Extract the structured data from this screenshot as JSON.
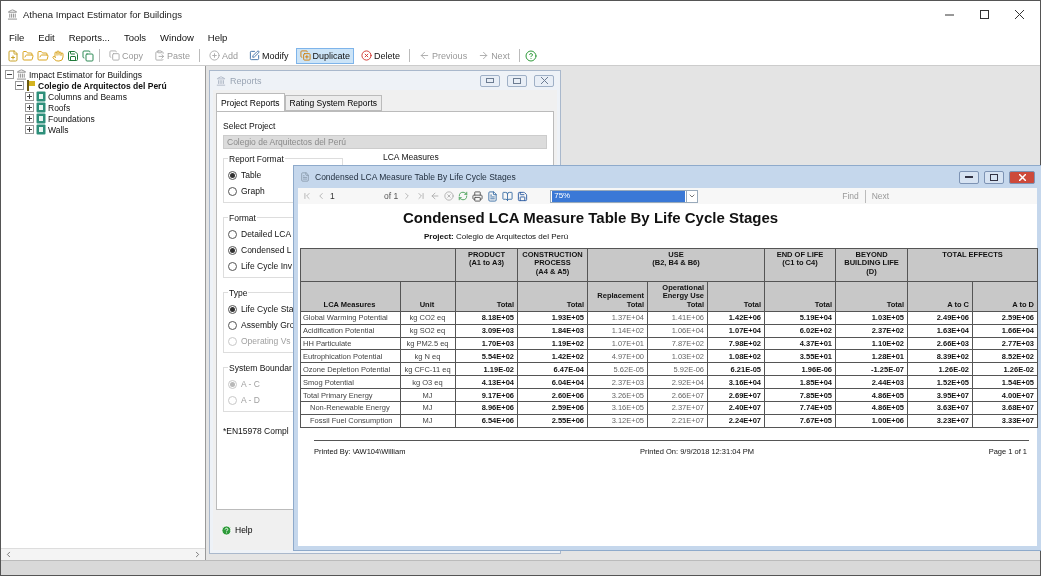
{
  "window": {
    "title": "Athena Impact Estimator for Buildings"
  },
  "menu": [
    "File",
    "Edit",
    "Reports...",
    "Tools",
    "Window",
    "Help"
  ],
  "toolbar": {
    "edit": [
      {
        "label": "Copy",
        "disabled": true,
        "highlighted": false
      },
      {
        "label": "Paste",
        "disabled": true,
        "highlighted": false
      }
    ],
    "actions": [
      {
        "label": "Add",
        "disabled": true,
        "highlighted": false
      },
      {
        "label": "Modify",
        "disabled": false,
        "highlighted": false
      },
      {
        "label": "Duplicate",
        "disabled": false,
        "highlighted": true
      },
      {
        "label": "Delete",
        "disabled": false,
        "highlighted": false
      }
    ],
    "navigation": [
      {
        "label": "Previous",
        "disabled": true,
        "highlighted": false
      },
      {
        "label": "Next",
        "disabled": true,
        "highlighted": false
      }
    ]
  },
  "tree": [
    {
      "label": "Impact Estimator for Buildings",
      "kind": "root",
      "expanded": true,
      "children": [
        {
          "label": "Colegio de Arquitectos del Perú",
          "kind": "project",
          "expanded": true,
          "children": [
            {
              "label": "Columns and Beams",
              "kind": "group",
              "expanded": false
            },
            {
              "label": "Roofs",
              "kind": "group",
              "expanded": false
            },
            {
              "label": "Foundations",
              "kind": "group",
              "expanded": false
            },
            {
              "label": "Walls",
              "kind": "group",
              "expanded": false
            }
          ]
        }
      ]
    }
  ],
  "reports_window": {
    "title": "Reports",
    "tabs": [
      {
        "label": "Project Reports",
        "selected": true
      },
      {
        "label": "Rating System Reports",
        "selected": false
      }
    ],
    "select_project": {
      "label": "Select Project",
      "value": "Colegio de Arquitectos del Perú",
      "disabled": true
    },
    "lca_measures_label": "LCA Measures",
    "groups": [
      {
        "title": "Report Format",
        "options": [
          {
            "label": "Table",
            "selected": true,
            "disabled": false
          },
          {
            "label": "Graph",
            "selected": false,
            "disabled": false
          }
        ]
      },
      {
        "title": "Format",
        "options": [
          {
            "label": "Detailed LCA",
            "selected": false,
            "disabled": false
          },
          {
            "label": "Condensed L",
            "selected": true,
            "disabled": false
          },
          {
            "label": "Life Cycle Inv",
            "selected": false,
            "disabled": false
          }
        ]
      },
      {
        "title": "Type",
        "options": [
          {
            "label": "Life Cycle Sta",
            "selected": true,
            "disabled": false
          },
          {
            "label": "Assembly Gro",
            "selected": false,
            "disabled": false
          },
          {
            "label": "Operating Vs",
            "selected": false,
            "disabled": true
          }
        ]
      },
      {
        "title": "System Boundar",
        "options": [
          {
            "label": "A - C",
            "selected": true,
            "disabled": true
          },
          {
            "label": "A - D",
            "selected": false,
            "disabled": true
          }
        ]
      }
    ],
    "note": "*EN15978 Compl",
    "help_button": "Help"
  },
  "viewer": {
    "title": "Condensed LCA Measure Table By Life Cycle Stages",
    "page": "1",
    "page_count": "of 1",
    "zoom": "75%",
    "find": "Find",
    "next": "Next",
    "report": {
      "title": "Condensed LCA Measure Table By Life Cycle Stages",
      "project_label": "Project:",
      "project": "Colegio de Arquitectos del Perú",
      "measure_columns": [
        "LCA Measures",
        "Unit"
      ],
      "stages": [
        {
          "name": "PRODUCT",
          "range": "(A1 to A3)",
          "columns": [
            {
              "label": "Total",
              "emphasis": true
            }
          ]
        },
        {
          "name": "CONSTRUCTION PROCESS",
          "range": "(A4 & A5)",
          "columns": [
            {
              "label": "Total",
              "emphasis": true
            }
          ]
        },
        {
          "name": "USE",
          "range": "(B2, B4 & B6)",
          "columns": [
            {
              "label": "Replacement Total",
              "emphasis": false
            },
            {
              "label": "Operational Energy Use Total",
              "emphasis": false
            },
            {
              "label": "Total",
              "emphasis": true
            }
          ]
        },
        {
          "name": "END OF LIFE",
          "range": "(C1 to C4)",
          "columns": [
            {
              "label": "Total",
              "emphasis": true
            }
          ]
        },
        {
          "name": "BEYOND BUILDING LIFE",
          "range": "(D)",
          "columns": [
            {
              "label": "Total",
              "emphasis": true
            }
          ]
        },
        {
          "name": "TOTAL EFFECTS",
          "columns": [
            {
              "label": "A to C",
              "emphasis": true
            },
            {
              "label": "A to D",
              "emphasis": true
            }
          ]
        }
      ],
      "rows": [
        {
          "measure": "Global Warming Potential",
          "unit": "kg CO2 eq",
          "values": [
            "8.18E+05",
            "1.93E+05",
            "1.37E+04",
            "1.41E+06",
            "1.42E+06",
            "5.19E+04",
            "1.03E+05",
            "2.49E+06",
            "2.59E+06"
          ]
        },
        {
          "measure": "Acidification Potential",
          "unit": "kg SO2 eq",
          "values": [
            "3.09E+03",
            "1.84E+03",
            "1.14E+02",
            "1.06E+04",
            "1.07E+04",
            "6.02E+02",
            "2.37E+02",
            "1.63E+04",
            "1.66E+04"
          ]
        },
        {
          "measure": "HH Particulate",
          "unit": "kg PM2.5 eq",
          "values": [
            "1.70E+03",
            "1.19E+02",
            "1.07E+01",
            "7.87E+02",
            "7.98E+02",
            "4.37E+01",
            "1.10E+02",
            "2.66E+03",
            "2.77E+03"
          ]
        },
        {
          "measure": "Eutrophication Potential",
          "unit": "kg N eq",
          "values": [
            "5.54E+02",
            "1.42E+02",
            "4.97E+00",
            "1.03E+02",
            "1.08E+02",
            "3.55E+01",
            "1.28E+01",
            "8.39E+02",
            "8.52E+02"
          ]
        },
        {
          "measure": "Ozone Depletion Potential",
          "unit": "kg CFC-11 eq",
          "values": [
            "1.19E-02",
            "6.47E-04",
            "5.62E-05",
            "5.92E-06",
            "6.21E-05",
            "1.96E-06",
            "-1.25E-07",
            "1.26E-02",
            "1.26E-02"
          ]
        },
        {
          "measure": "Smog Potential",
          "unit": "kg O3 eq",
          "values": [
            "4.13E+04",
            "6.04E+04",
            "2.37E+03",
            "2.92E+04",
            "3.16E+04",
            "1.85E+04",
            "2.44E+03",
            "1.52E+05",
            "1.54E+05"
          ]
        },
        {
          "measure": "Total Primary Energy",
          "unit": "MJ",
          "values": [
            "9.17E+06",
            "2.60E+06",
            "3.26E+05",
            "2.66E+07",
            "2.69E+07",
            "7.85E+05",
            "4.86E+05",
            "3.95E+07",
            "4.00E+07"
          ],
          "children": [
            {
              "measure": "Non-Renewable Energy",
              "unit": "MJ",
              "values": [
                "8.96E+06",
                "2.59E+06",
                "3.16E+05",
                "2.37E+07",
                "2.40E+07",
                "7.74E+05",
                "4.86E+05",
                "3.63E+07",
                "3.68E+07"
              ]
            },
            {
              "measure": "Fossil Fuel Consumption",
              "unit": "MJ",
              "values": [
                "6.54E+06",
                "2.55E+06",
                "3.12E+05",
                "2.21E+07",
                "2.24E+07",
                "7.67E+05",
                "1.00E+06",
                "3.23E+07",
                "3.33E+07"
              ]
            }
          ]
        }
      ],
      "footer": {
        "printed_by": "Printed By: \\AW104\\William",
        "printed_on": "Printed On: 9/9/2018 12:31:04 PM",
        "page": "Page 1 of 1"
      }
    }
  }
}
